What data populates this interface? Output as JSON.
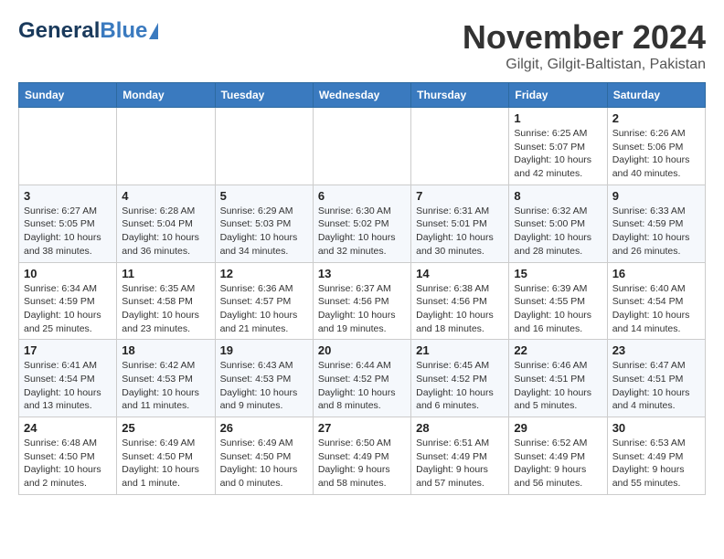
{
  "header": {
    "logo_general": "General",
    "logo_blue": "Blue",
    "month_title": "November 2024",
    "location": "Gilgit, Gilgit-Baltistan, Pakistan"
  },
  "columns": [
    "Sunday",
    "Monday",
    "Tuesday",
    "Wednesday",
    "Thursday",
    "Friday",
    "Saturday"
  ],
  "weeks": [
    {
      "days": [
        {
          "number": "",
          "info": ""
        },
        {
          "number": "",
          "info": ""
        },
        {
          "number": "",
          "info": ""
        },
        {
          "number": "",
          "info": ""
        },
        {
          "number": "",
          "info": ""
        },
        {
          "number": "1",
          "info": "Sunrise: 6:25 AM\nSunset: 5:07 PM\nDaylight: 10 hours\nand 42 minutes."
        },
        {
          "number": "2",
          "info": "Sunrise: 6:26 AM\nSunset: 5:06 PM\nDaylight: 10 hours\nand 40 minutes."
        }
      ]
    },
    {
      "days": [
        {
          "number": "3",
          "info": "Sunrise: 6:27 AM\nSunset: 5:05 PM\nDaylight: 10 hours\nand 38 minutes."
        },
        {
          "number": "4",
          "info": "Sunrise: 6:28 AM\nSunset: 5:04 PM\nDaylight: 10 hours\nand 36 minutes."
        },
        {
          "number": "5",
          "info": "Sunrise: 6:29 AM\nSunset: 5:03 PM\nDaylight: 10 hours\nand 34 minutes."
        },
        {
          "number": "6",
          "info": "Sunrise: 6:30 AM\nSunset: 5:02 PM\nDaylight: 10 hours\nand 32 minutes."
        },
        {
          "number": "7",
          "info": "Sunrise: 6:31 AM\nSunset: 5:01 PM\nDaylight: 10 hours\nand 30 minutes."
        },
        {
          "number": "8",
          "info": "Sunrise: 6:32 AM\nSunset: 5:00 PM\nDaylight: 10 hours\nand 28 minutes."
        },
        {
          "number": "9",
          "info": "Sunrise: 6:33 AM\nSunset: 4:59 PM\nDaylight: 10 hours\nand 26 minutes."
        }
      ]
    },
    {
      "days": [
        {
          "number": "10",
          "info": "Sunrise: 6:34 AM\nSunset: 4:59 PM\nDaylight: 10 hours\nand 25 minutes."
        },
        {
          "number": "11",
          "info": "Sunrise: 6:35 AM\nSunset: 4:58 PM\nDaylight: 10 hours\nand 23 minutes."
        },
        {
          "number": "12",
          "info": "Sunrise: 6:36 AM\nSunset: 4:57 PM\nDaylight: 10 hours\nand 21 minutes."
        },
        {
          "number": "13",
          "info": "Sunrise: 6:37 AM\nSunset: 4:56 PM\nDaylight: 10 hours\nand 19 minutes."
        },
        {
          "number": "14",
          "info": "Sunrise: 6:38 AM\nSunset: 4:56 PM\nDaylight: 10 hours\nand 18 minutes."
        },
        {
          "number": "15",
          "info": "Sunrise: 6:39 AM\nSunset: 4:55 PM\nDaylight: 10 hours\nand 16 minutes."
        },
        {
          "number": "16",
          "info": "Sunrise: 6:40 AM\nSunset: 4:54 PM\nDaylight: 10 hours\nand 14 minutes."
        }
      ]
    },
    {
      "days": [
        {
          "number": "17",
          "info": "Sunrise: 6:41 AM\nSunset: 4:54 PM\nDaylight: 10 hours\nand 13 minutes."
        },
        {
          "number": "18",
          "info": "Sunrise: 6:42 AM\nSunset: 4:53 PM\nDaylight: 10 hours\nand 11 minutes."
        },
        {
          "number": "19",
          "info": "Sunrise: 6:43 AM\nSunset: 4:53 PM\nDaylight: 10 hours\nand 9 minutes."
        },
        {
          "number": "20",
          "info": "Sunrise: 6:44 AM\nSunset: 4:52 PM\nDaylight: 10 hours\nand 8 minutes."
        },
        {
          "number": "21",
          "info": "Sunrise: 6:45 AM\nSunset: 4:52 PM\nDaylight: 10 hours\nand 6 minutes."
        },
        {
          "number": "22",
          "info": "Sunrise: 6:46 AM\nSunset: 4:51 PM\nDaylight: 10 hours\nand 5 minutes."
        },
        {
          "number": "23",
          "info": "Sunrise: 6:47 AM\nSunset: 4:51 PM\nDaylight: 10 hours\nand 4 minutes."
        }
      ]
    },
    {
      "days": [
        {
          "number": "24",
          "info": "Sunrise: 6:48 AM\nSunset: 4:50 PM\nDaylight: 10 hours\nand 2 minutes."
        },
        {
          "number": "25",
          "info": "Sunrise: 6:49 AM\nSunset: 4:50 PM\nDaylight: 10 hours\nand 1 minute."
        },
        {
          "number": "26",
          "info": "Sunrise: 6:49 AM\nSunset: 4:50 PM\nDaylight: 10 hours\nand 0 minutes."
        },
        {
          "number": "27",
          "info": "Sunrise: 6:50 AM\nSunset: 4:49 PM\nDaylight: 9 hours\nand 58 minutes."
        },
        {
          "number": "28",
          "info": "Sunrise: 6:51 AM\nSunset: 4:49 PM\nDaylight: 9 hours\nand 57 minutes."
        },
        {
          "number": "29",
          "info": "Sunrise: 6:52 AM\nSunset: 4:49 PM\nDaylight: 9 hours\nand 56 minutes."
        },
        {
          "number": "30",
          "info": "Sunrise: 6:53 AM\nSunset: 4:49 PM\nDaylight: 9 hours\nand 55 minutes."
        }
      ]
    }
  ]
}
